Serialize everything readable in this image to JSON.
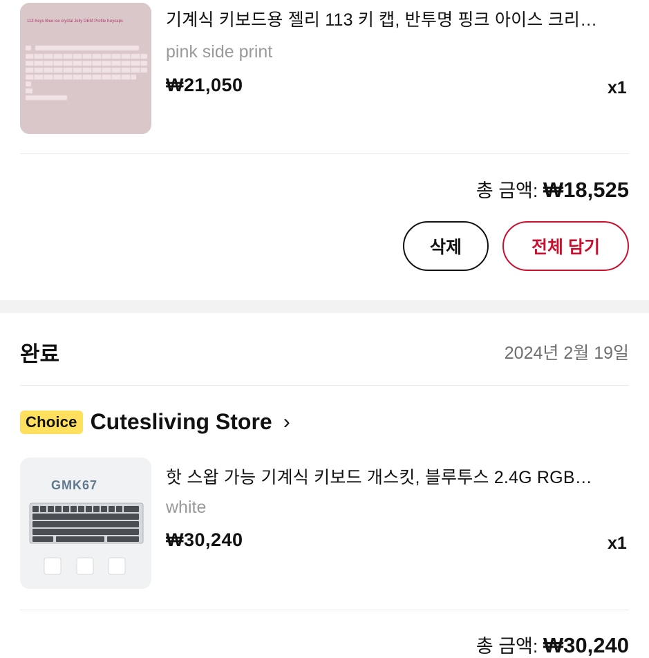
{
  "item1": {
    "title": "기계식 키보드용 젤리 113 키 캡, 반투명 핑크 아이스 크리…",
    "variant": "pink side print",
    "price": "₩21,050",
    "qty": "x1",
    "thumb_caption": "113 Keys Blue ice crystal Jelly OEM Profile Keycaps"
  },
  "order1": {
    "total_label": "총 금액:",
    "total_value": "₩18,525",
    "delete_label": "삭제",
    "add_all_label": "전체 담기"
  },
  "order2": {
    "status": "완료",
    "date": "2024년 2월 19일",
    "badge": "Choice",
    "store_name": "Cutesliving Store",
    "store_chevron": "›",
    "total_label": "총 금액:",
    "total_value": "₩30,240"
  },
  "item2": {
    "title": "핫 스왑 가능 기계식 키보드 개스킷, 블루투스 2.4G RGB…",
    "variant": "white",
    "price": "₩30,240",
    "qty": "x1",
    "thumb_brand": "GMK67"
  },
  "colors": {
    "accent": "#c8102e",
    "badge": "#ffdf5e"
  }
}
